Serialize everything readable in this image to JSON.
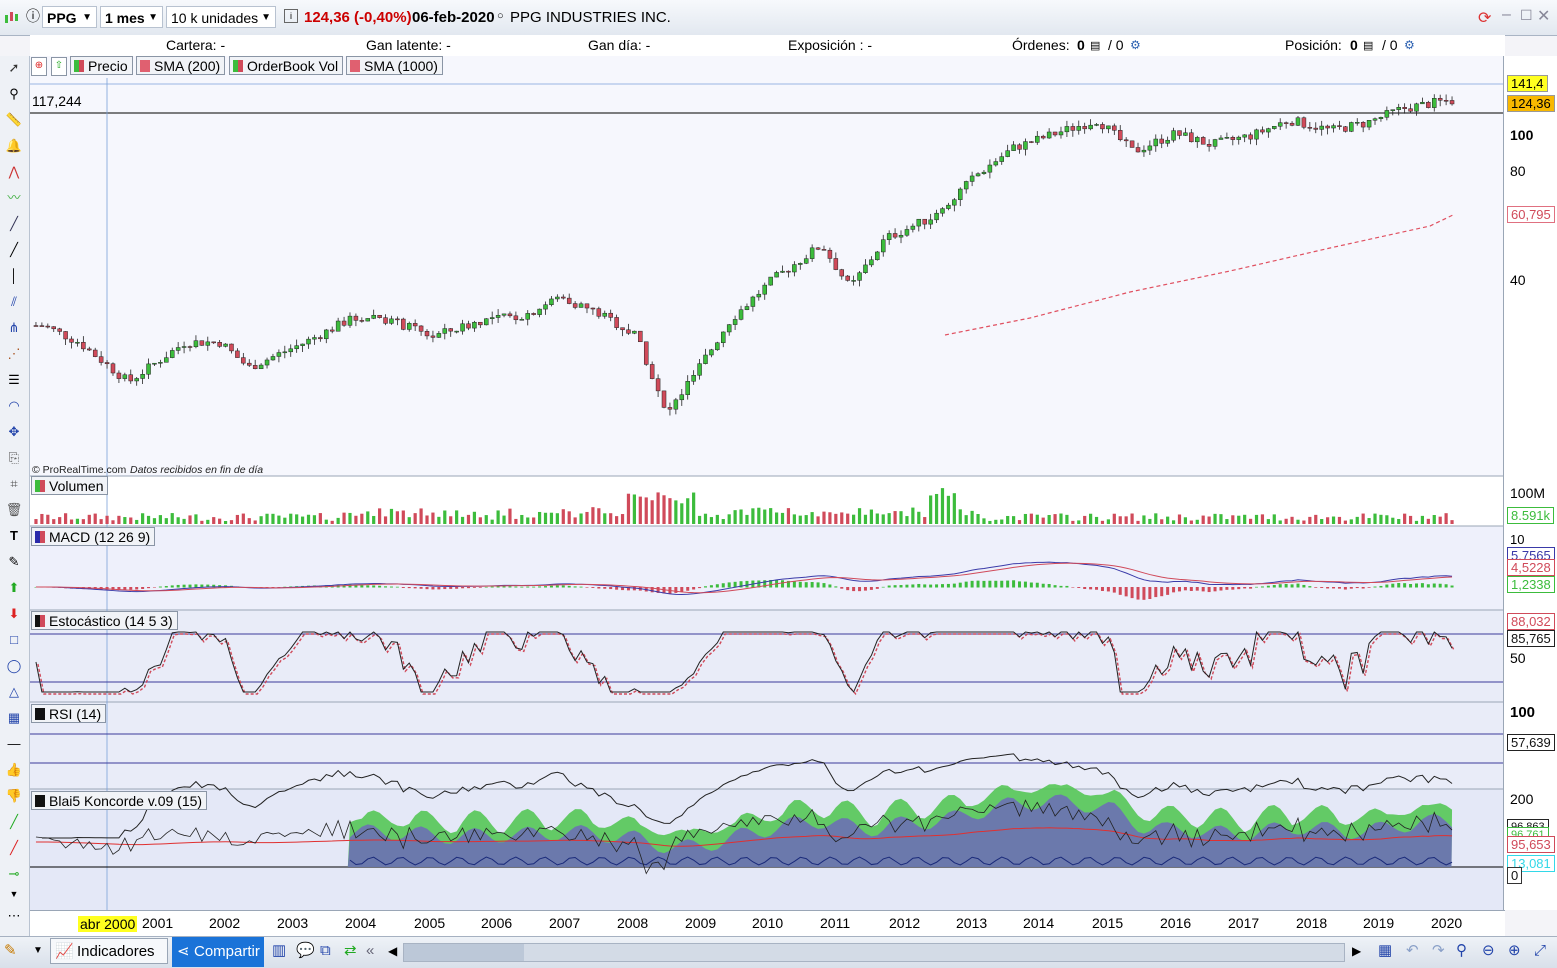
{
  "toolbar": {
    "symbol": "PPG",
    "period": "1 mes",
    "units": "10 k unidades",
    "price_change": "124,36 (-0,40%)",
    "date": "06-feb-2020",
    "company": "PPG INDUSTRIES INC."
  },
  "infobar": {
    "cartera": "Cartera: -",
    "gan_latente": "Gan latente: -",
    "gan_dia": "Gan día: -",
    "exposicion": "Exposición : -",
    "ordenes_label": "Órdenes:",
    "ordenes_a": "0",
    "ordenes_b": "/ 0",
    "posicion_label": "Posición:",
    "posicion_a": "0",
    "posicion_b": "/ 0"
  },
  "price_panel": {
    "legend": [
      "Precio",
      "SMA (200)",
      "OrderBook Vol",
      "SMA (1000)"
    ],
    "crosshair_value": "117,244",
    "watermark": "© ProRealTime.com",
    "watermark_note": "Datos recibidos en fin de día",
    "axis_labels": [
      "100",
      "80",
      "40"
    ],
    "tag_high": "141,4",
    "tag_last": "124,36",
    "tag_sma": "60,795"
  },
  "volume_panel": {
    "legend": "Volumen",
    "axis_label": "100M",
    "tag": "8.591k"
  },
  "macd_panel": {
    "legend": "MACD (12 26 9)",
    "axis_label": "10",
    "tag_macd": "5,7565",
    "tag_signal": "4,5228",
    "tag_hist": "1,2338"
  },
  "stoch_panel": {
    "legend": "Estocástico (14 5 3)",
    "tag_k": "88,032",
    "tag_d": "85,765",
    "axis_label": "50"
  },
  "rsi_panel": {
    "legend": "RSI (14)",
    "axis_label": "100",
    "tag": "57,639"
  },
  "koncorde_panel": {
    "legend": "Blai5 Koncorde v.09 (15)",
    "axis_top": "200",
    "axis_zero": "0",
    "tag_1": "96,863",
    "tag_2": "96,761",
    "tag_3": "95,653",
    "tag_4": "13,081"
  },
  "xaxis": {
    "cursor_label": "abr 2000",
    "years": [
      "2001",
      "2002",
      "2003",
      "2004",
      "2005",
      "2006",
      "2007",
      "2008",
      "2009",
      "2010",
      "2011",
      "2012",
      "2013",
      "2014",
      "2015",
      "2016",
      "2017",
      "2018",
      "2019",
      "2020"
    ]
  },
  "bottombar": {
    "indicadores": "Indicadores",
    "compartir": "Compartir"
  },
  "colors": {
    "up": "#3cbc3c",
    "down": "#d04a5a",
    "panel_bg": "#eceefa",
    "sma": "#e0505a"
  },
  "chart_data": {
    "type": "candlestick",
    "series": [
      {
        "name": "Precio",
        "x": [
          2000.3,
          2000.8,
          2001.5,
          2002.3,
          2002.8,
          2003.2,
          2004.0,
          2004.6,
          2005.0,
          2005.8,
          2006.5,
          2007.1,
          2007.6,
          2008.2,
          2008.7,
          2009.1,
          2009.5,
          2010.0,
          2010.6,
          2011.3,
          2011.7,
          2012.2,
          2012.9,
          2013.5,
          2014.0,
          2014.6,
          2015.2,
          2015.7,
          2016.3,
          2016.8,
          2017.4,
          2017.9,
          2018.5,
          2019.0,
          2019.5,
          2020.1
        ],
        "y": [
          30,
          27,
          21,
          27,
          27,
          23,
          27,
          31,
          32,
          28,
          31,
          32,
          36,
          32,
          28,
          17,
          22,
          31,
          40,
          50,
          38,
          52,
          60,
          78,
          92,
          101,
          110,
          90,
          101,
          94,
          100,
          110,
          103,
          108,
          118,
          124
        ]
      },
      {
        "name": "SMA (1000)",
        "x": [
          2012.6,
          2020.1
        ],
        "y": [
          33,
          61
        ]
      }
    ],
    "y_axis_labels": [
      100,
      80,
      40
    ],
    "scale": "log"
  }
}
